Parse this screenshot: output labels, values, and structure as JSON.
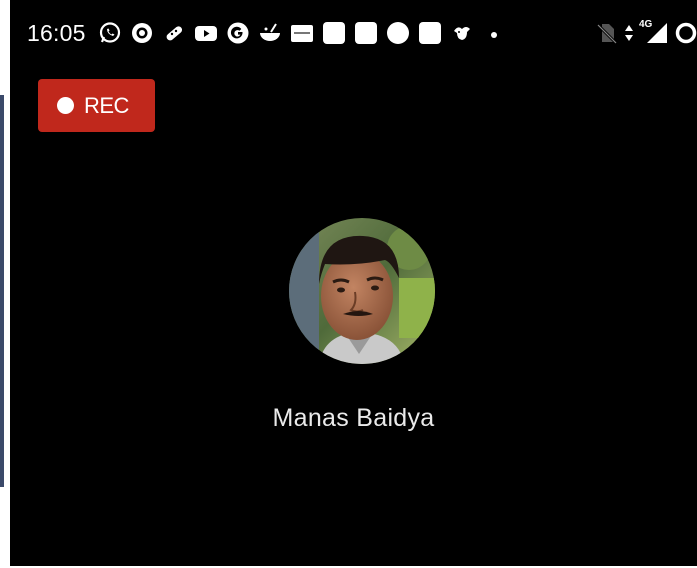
{
  "status_bar": {
    "time": "16:05",
    "network_label": "4G",
    "notification_icons": [
      "whatsapp-icon",
      "recorder-icon",
      "pill-icon",
      "youtube-icon",
      "google-icon",
      "cooking-icon",
      "amazon-icon",
      "square-icon",
      "square-icon",
      "circle-icon",
      "square-icon",
      "bird-icon",
      "dot-icon"
    ],
    "system_icons": [
      "no-sim-icon",
      "data-arrows-icon",
      "signal-icon",
      "battery-ring-icon"
    ]
  },
  "rec_button": {
    "label": "REC",
    "color": "#c0281c"
  },
  "call": {
    "caller_name": "Manas Baidya"
  }
}
